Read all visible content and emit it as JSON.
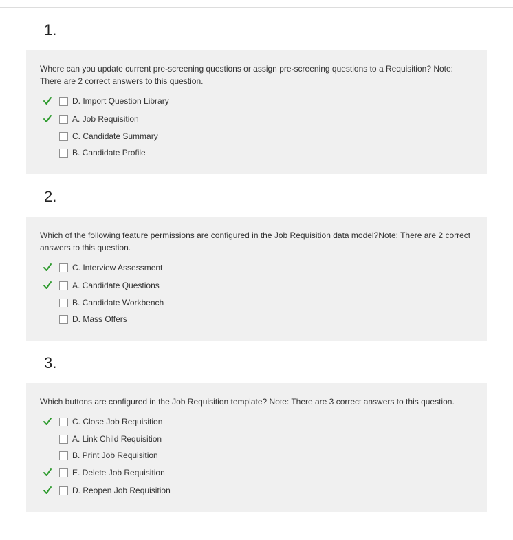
{
  "questions": [
    {
      "number": "1.",
      "text": "Where can you update current pre-screening questions or assign pre-screening questions to a Requisition? Note: There are 2 correct answers to this question.",
      "answers": [
        {
          "label": "D. Import Question Library",
          "correct": true
        },
        {
          "label": "A. Job Requisition",
          "correct": true
        },
        {
          "label": "C. Candidate Summary",
          "correct": false
        },
        {
          "label": "B. Candidate Profile",
          "correct": false
        }
      ]
    },
    {
      "number": "2.",
      "text": "Which of the following feature permissions are configured in the Job Requisition data model?Note: There are 2 correct answers to this question.",
      "answers": [
        {
          "label": "C. Interview Assessment",
          "correct": true
        },
        {
          "label": "A. Candidate Questions",
          "correct": true
        },
        {
          "label": "B. Candidate Workbench",
          "correct": false
        },
        {
          "label": "D. Mass Offers",
          "correct": false
        }
      ]
    },
    {
      "number": "3.",
      "text": "Which buttons are configured in the Job Requisition template? Note: There are 3 correct answers to this question.",
      "answers": [
        {
          "label": "C. Close Job Requisition",
          "correct": true
        },
        {
          "label": "A. Link Child Requisition",
          "correct": false
        },
        {
          "label": "B. Print Job Requisition",
          "correct": false
        },
        {
          "label": "E. Delete Job Requisition",
          "correct": true
        },
        {
          "label": "D. Reopen Job Requisition",
          "correct": true
        }
      ]
    }
  ]
}
